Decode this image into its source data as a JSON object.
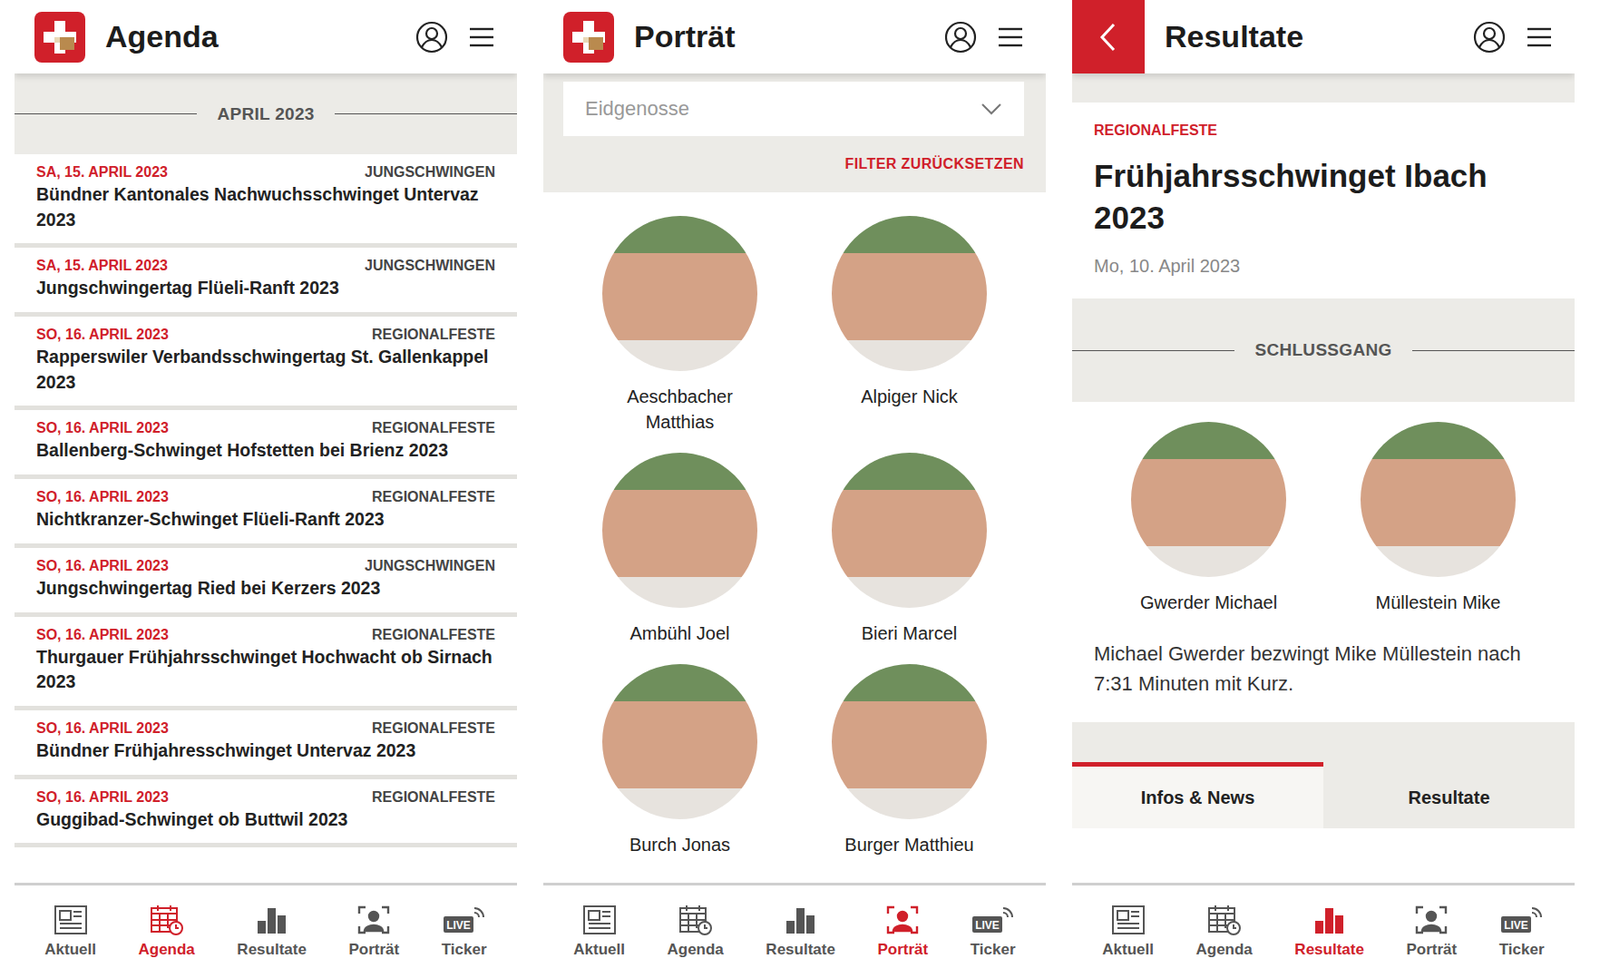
{
  "screens": [
    {
      "kind": "agenda",
      "title": "Agenda",
      "back": false,
      "month": "APRIL 2023",
      "events": [
        {
          "date": "SA, 15. APRIL 2023",
          "category": "JUNGSCHWINGEN",
          "title": "Bündner Kantonales Nachwuchsschwinget Untervaz 2023"
        },
        {
          "date": "SA, 15. APRIL 2023",
          "category": "JUNGSCHWINGEN",
          "title": "Jungschwingertag Flüeli-Ranft 2023"
        },
        {
          "date": "SO, 16. APRIL 2023",
          "category": "REGIONALFESTE",
          "title": "Rapperswiler Verbandsschwingertag St. Gallenkappel 2023"
        },
        {
          "date": "SO, 16. APRIL 2023",
          "category": "REGIONALFESTE",
          "title": "Ballenberg-Schwinget Hofstetten bei Brienz 2023"
        },
        {
          "date": "SO, 16. APRIL 2023",
          "category": "REGIONALFESTE",
          "title": "Nichtkranzer-Schwinget Flüeli-Ranft 2023"
        },
        {
          "date": "SO, 16. APRIL 2023",
          "category": "JUNGSCHWINGEN",
          "title": "Jungschwingertag Ried bei Kerzers 2023"
        },
        {
          "date": "SO, 16. APRIL 2023",
          "category": "REGIONALFESTE",
          "title": "Thurgauer Frühjahrsschwinget Hochwacht ob Sirnach 2023"
        },
        {
          "date": "SO, 16. APRIL 2023",
          "category": "REGIONALFESTE",
          "title": "Bündner Frühjahresschwinget Untervaz 2023"
        },
        {
          "date": "SO, 16. APRIL 2023",
          "category": "REGIONALFESTE",
          "title": "Guggibad-Schwinget ob Buttwil 2023"
        }
      ],
      "nav": [
        {
          "label": "Aktuell",
          "selected": false
        },
        {
          "label": "Agenda",
          "selected": true
        },
        {
          "label": "Resultate",
          "selected": false
        },
        {
          "label": "Porträt",
          "selected": false
        },
        {
          "label": "Ticker",
          "selected": false,
          "badge": "LIVE"
        }
      ]
    },
    {
      "kind": "portrait",
      "title": "Porträt",
      "back": false,
      "filter": {
        "placeholder": "Eidgenosse",
        "reset": "FILTER ZURÜCKSETZEN"
      },
      "athletes": [
        {
          "name": "Aeschbacher Matthias"
        },
        {
          "name": "Alpiger Nick"
        },
        {
          "name": "Ambühl Joel"
        },
        {
          "name": "Bieri Marcel"
        },
        {
          "name": "Burch Jonas"
        },
        {
          "name": "Burger Matthieu"
        }
      ],
      "nav": [
        {
          "label": "Aktuell",
          "selected": false
        },
        {
          "label": "Agenda",
          "selected": false
        },
        {
          "label": "Resultate",
          "selected": false
        },
        {
          "label": "Porträt",
          "selected": true
        },
        {
          "label": "Ticker",
          "selected": false,
          "badge": "LIVE"
        }
      ]
    },
    {
      "kind": "result",
      "title": "Resultate",
      "back": true,
      "category": "REGIONALFESTE",
      "event": "Frühjahrsschwinget Ibach 2023",
      "date": "Mo, 10. April 2023",
      "section": "SCHLUSSGANG",
      "wrestlers": [
        {
          "name": "Gwerder Michael"
        },
        {
          "name": "Müllestein Mike"
        }
      ],
      "summary": "Michael Gwerder bezwingt Mike Müllestein nach 7:31 Minuten mit Kurz.",
      "tabs": [
        {
          "label": "Infos & News",
          "selected": true
        },
        {
          "label": "Resultate",
          "selected": false
        }
      ],
      "nav": [
        {
          "label": "Aktuell",
          "selected": false
        },
        {
          "label": "Agenda",
          "selected": false
        },
        {
          "label": "Resultate",
          "selected": true
        },
        {
          "label": "Porträt",
          "selected": false
        },
        {
          "label": "Ticker",
          "selected": false,
          "badge": "LIVE"
        }
      ]
    }
  ]
}
